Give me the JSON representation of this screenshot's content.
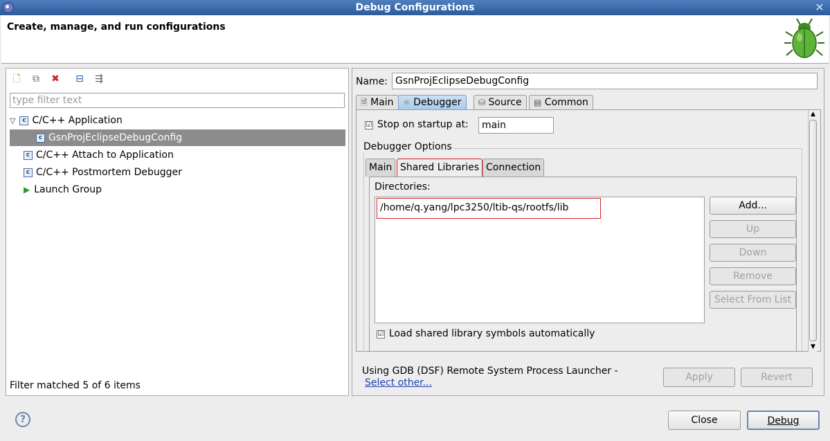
{
  "window": {
    "title": "Debug Configurations",
    "close_glyph": "✕"
  },
  "banner": {
    "title": "Create, manage, and run configurations",
    "icon": "bug-icon"
  },
  "left": {
    "toolbar": {
      "new_glyph": "🗋",
      "duplicate_glyph": "⧉",
      "delete_glyph": "✖",
      "collapse_glyph": "⊟",
      "filter_glyph": "⇶"
    },
    "filter_placeholder": "type filter text",
    "tree": {
      "cpp_app": "C/C++ Application",
      "config": "GsnProjEclipseDebugConfig",
      "attach": "C/C++ Attach to Application",
      "postmortem": "C/C++ Postmortem Debugger",
      "launch_group": "Launch Group",
      "expand_glyph": "▽",
      "c_glyph": "c",
      "launch_glyph": "▶"
    },
    "status": "Filter matched 5 of 6 items"
  },
  "right": {
    "name_label": "Name:",
    "name_value": "GsnProjEclipseDebugConfig",
    "tabs": {
      "main": "Main",
      "debugger": "Debugger",
      "source": "Source",
      "common": "Common"
    },
    "stop_on_startup_label": "Stop on startup at:",
    "stop_on_startup_value": "main",
    "debugger_options_title": "Debugger Options",
    "sub_tabs": {
      "main": "Main",
      "shared_libraries": "Shared Libraries",
      "connection": "Connection"
    },
    "directories_label": "Directories:",
    "directory_item": "/home/q.yang/lpc3250/ltib-qs/rootfs/lib",
    "buttons": {
      "add": "Add...",
      "up": "Up",
      "down": "Down",
      "remove": "Remove",
      "select_from_list": "Select From List"
    },
    "load_symbols_label": "Load shared library symbols automatically",
    "launcher_text": "Using GDB (DSF) Remote System Process Launcher -",
    "select_other": "Select other...",
    "apply": "Apply",
    "revert": "Revert",
    "check_glyph": "☑"
  },
  "footer": {
    "help_glyph": "?",
    "close": "Close",
    "debug": "Debug"
  }
}
